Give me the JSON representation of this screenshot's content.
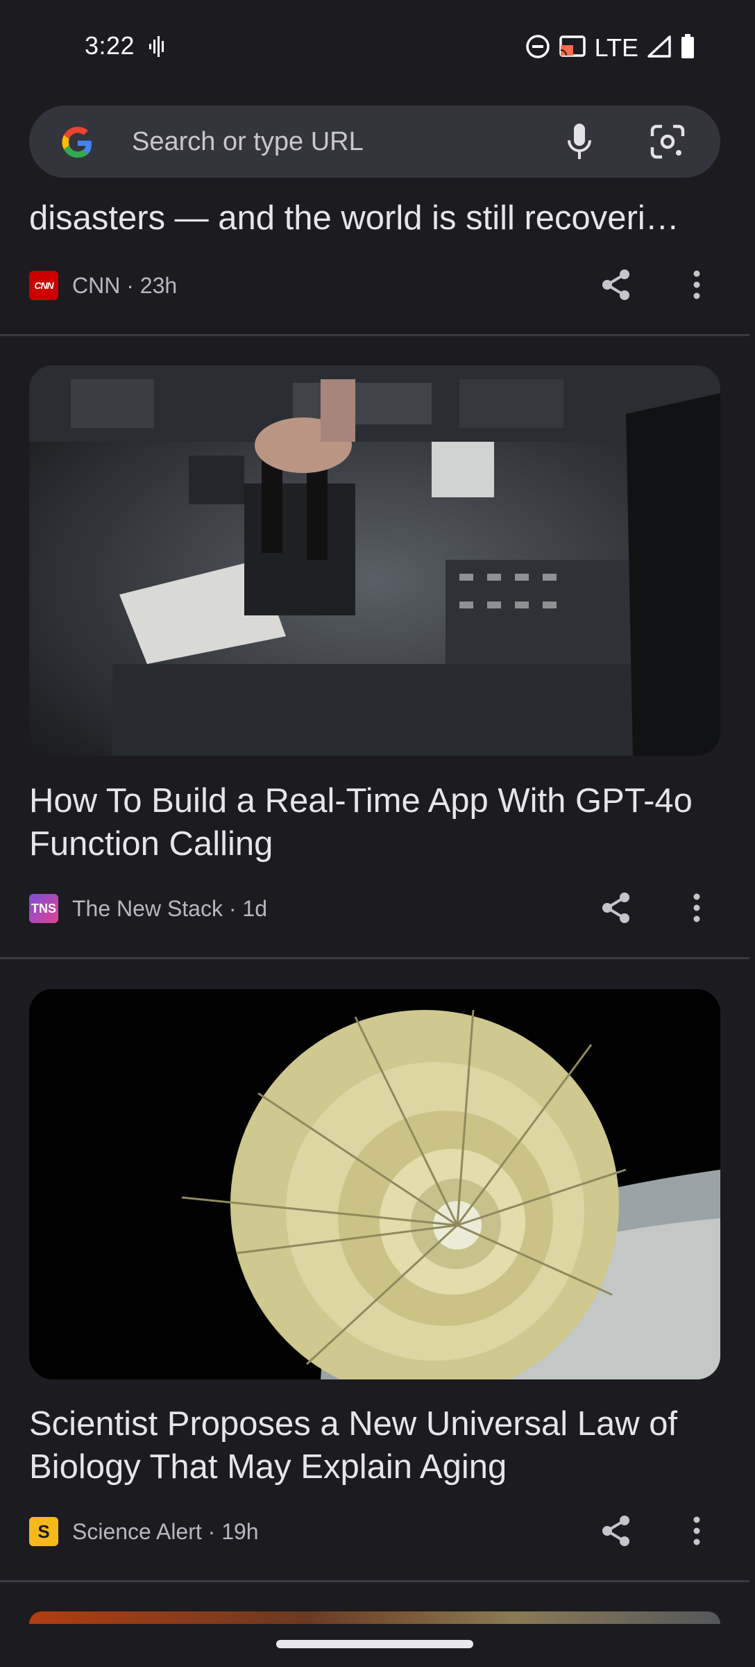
{
  "status_bar": {
    "time": "3:22",
    "network": "LTE"
  },
  "search": {
    "placeholder": "Search or type URL"
  },
  "articles": [
    {
      "headline": "disasters — and the world is still recoveri…",
      "source_logo": "CNN",
      "source": "CNN · 23h"
    },
    {
      "headline": "How To Build a Real-Time App With GPT-4o Function Calling",
      "source_logo": "TNS",
      "source": "The New Stack · 1d",
      "image": "aircraft-cockpit-throttle"
    },
    {
      "headline": "Scientist Proposes a New Universal Law of Biology That May Explain Aging",
      "source_logo": "S",
      "source": "Science Alert · 19h",
      "image": "nautilus-shell"
    }
  ],
  "colors": {
    "background": "#1b1b20",
    "search_bar": "#34343d",
    "cnn_red": "#cc0000",
    "science_alert_yellow": "#f5b91a"
  }
}
